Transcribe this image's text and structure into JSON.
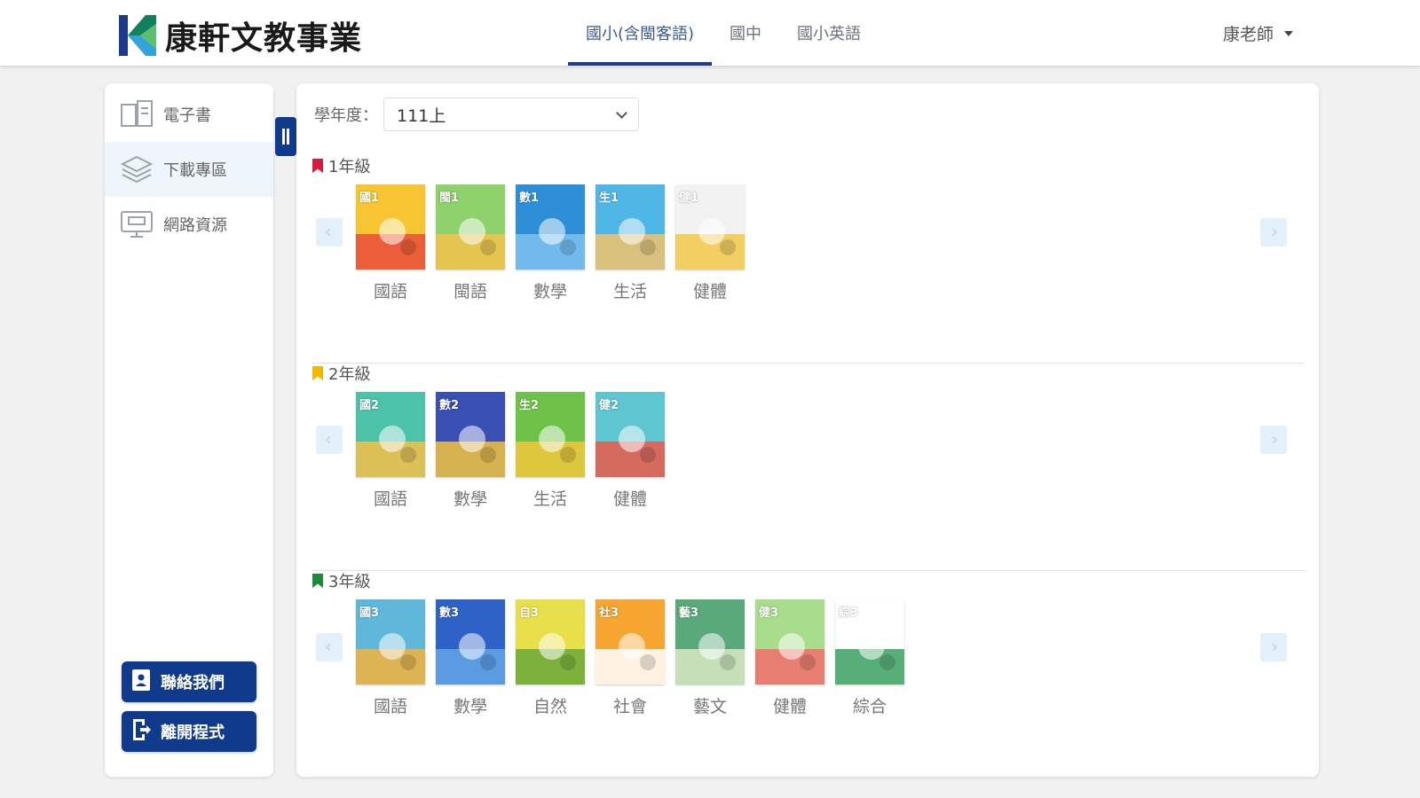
{
  "header": {
    "brand": "康軒文教事業",
    "tabs": [
      {
        "label": "國小(含閩客語)",
        "active": true
      },
      {
        "label": "國中",
        "active": false
      },
      {
        "label": "國小英語",
        "active": false
      }
    ],
    "user": "康老師"
  },
  "sidebar": {
    "items": [
      {
        "label": "電子書",
        "icon": "ebook-icon",
        "active": false
      },
      {
        "label": "下載專區",
        "icon": "layers-icon",
        "active": true
      },
      {
        "label": "網路資源",
        "icon": "monitor-icon",
        "active": false
      }
    ],
    "buttons": [
      {
        "label": "聯絡我們",
        "icon": "contact-book-icon"
      },
      {
        "label": "離開程式",
        "icon": "exit-icon"
      }
    ]
  },
  "main": {
    "year_label": "學年度：",
    "year_value": "111上",
    "grades": [
      {
        "title": "1年級",
        "color": "#d81b3c",
        "books": [
          {
            "label": "國語",
            "c1": "#f6c531",
            "c2": "#e94b3c",
            "cover_text": "國1"
          },
          {
            "label": "閩語",
            "c1": "#8fd16b",
            "c2": "#f3c34b",
            "cover_text": "閩1"
          },
          {
            "label": "數學",
            "c1": "#2e8fd6",
            "c2": "#7cc2ef",
            "cover_text": "數1"
          },
          {
            "label": "生活",
            "c1": "#4fb7e6",
            "c2": "#f1c26a",
            "cover_text": "生1"
          },
          {
            "label": "健體",
            "c1": "#f2f2f2",
            "c2": "#f3c84a",
            "cover_text": "健1"
          }
        ]
      },
      {
        "title": "2年級",
        "color": "#f2b705",
        "books": [
          {
            "label": "國語",
            "c1": "#4cc2a8",
            "c2": "#f5c04a",
            "cover_text": "國2"
          },
          {
            "label": "數學",
            "c1": "#3a4fb3",
            "c2": "#f2c23d",
            "cover_text": "數2"
          },
          {
            "label": "生活",
            "c1": "#6fc248",
            "c2": "#f0c83c",
            "cover_text": "生2"
          },
          {
            "label": "健體",
            "c1": "#5ec6d0",
            "c2": "#e95a4a",
            "cover_text": "健2"
          }
        ]
      },
      {
        "title": "3年級",
        "color": "#1f8a3b",
        "books": [
          {
            "label": "國語",
            "c1": "#5fb8d9",
            "c2": "#f4b13c",
            "cover_text": "國3"
          },
          {
            "label": "數學",
            "c1": "#2f62c6",
            "c2": "#62a6e6",
            "cover_text": "數3"
          },
          {
            "label": "自然",
            "c1": "#e8e04a",
            "c2": "#6aa83a",
            "cover_text": "自3"
          },
          {
            "label": "社會",
            "c1": "#f6a531",
            "c2": "#ffffff",
            "cover_text": "社3"
          },
          {
            "label": "藝文",
            "c1": "#5aa97a",
            "c2": "#d9e9c4",
            "cover_text": "藝3"
          },
          {
            "label": "健體",
            "c1": "#a8dd8c",
            "c2": "#f36d6d",
            "cover_text": "健3"
          },
          {
            "label": "綜合",
            "c1": "#ffffff",
            "c2": "#3aa062",
            "cover_text": "綜3"
          }
        ]
      }
    ]
  },
  "colors": {
    "primary": "#103a8c",
    "tab_active": "#1f3a8a",
    "nav_btn_bg": "#e3f0f9"
  }
}
